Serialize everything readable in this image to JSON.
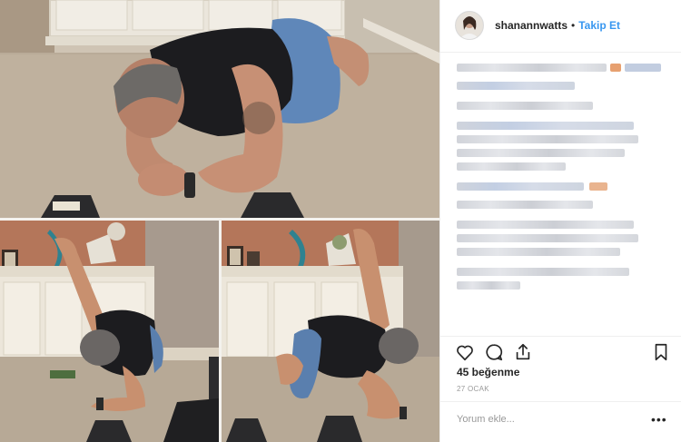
{
  "post": {
    "username": "shanannwatts",
    "separator": "•",
    "follow_label": "Takip Et",
    "likes": "45 beğenme",
    "date": "27 OCAK",
    "comment_placeholder": "Yorum ekle...",
    "more_label": "•••"
  },
  "icons": {
    "like": "heart-icon",
    "comment": "comment-icon",
    "share": "share-icon",
    "save": "bookmark-icon",
    "more": "more-options-icon"
  },
  "colors": {
    "link_blue": "#3897f0",
    "text_dark": "#262626",
    "text_muted": "#999999",
    "border": "#efefef"
  }
}
